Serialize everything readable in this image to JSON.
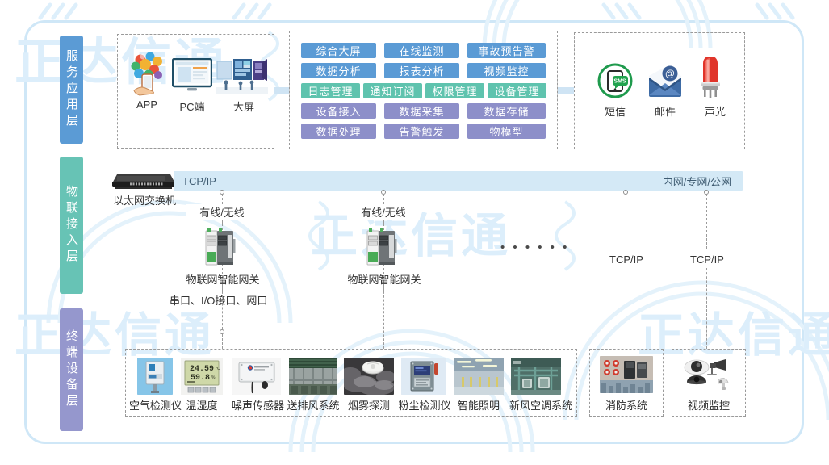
{
  "layers": [
    {
      "id": "service-application-layer",
      "label": "服务应用层"
    },
    {
      "id": "iot-access-layer",
      "label": "物联接入层"
    },
    {
      "id": "terminal-device-layer",
      "label": "终端设备层"
    }
  ],
  "clients": {
    "items": [
      {
        "id": "app",
        "label": "APP",
        "icon": "app-tree-icon"
      },
      {
        "id": "pc",
        "label": "PC端",
        "icon": "monitor-icon"
      },
      {
        "id": "bigscreen",
        "label": "大屏",
        "icon": "video-wall-icon"
      }
    ]
  },
  "platform": {
    "rows": [
      {
        "color": "blue",
        "items": [
          {
            "label": "综合大屏"
          },
          {
            "label": "在线监测"
          },
          {
            "label": "事故预告警"
          }
        ]
      },
      {
        "color": "blue",
        "items": [
          {
            "label": "数据分析"
          },
          {
            "label": "报表分析"
          },
          {
            "label": "视频监控"
          }
        ]
      },
      {
        "color": "teal",
        "items": [
          {
            "label": "日志管理"
          },
          {
            "label": "通知订阅"
          },
          {
            "label": "权限管理"
          },
          {
            "label": "设备管理"
          }
        ]
      },
      {
        "color": "purple",
        "items": [
          {
            "label": "设备接入"
          },
          {
            "label": "数据采集"
          },
          {
            "label": "数据存储"
          }
        ]
      },
      {
        "color": "purple",
        "items": [
          {
            "label": "数据处理"
          },
          {
            "label": "告警触发"
          },
          {
            "label": "物模型"
          }
        ]
      }
    ]
  },
  "notify": {
    "items": [
      {
        "id": "sms",
        "label": "短信",
        "icon": "sms-phone-icon",
        "color": "#1f9a4d"
      },
      {
        "id": "email",
        "label": "邮件",
        "icon": "envelope-at-icon",
        "color": "#31578f"
      },
      {
        "id": "alarm",
        "label": "声光",
        "icon": "beacon-light-icon",
        "color": "#d9342b"
      }
    ]
  },
  "access": {
    "switch": {
      "label": "以太网交换机",
      "icon": "ethernet-switch-icon"
    },
    "network_bar": {
      "left_label": "TCP/IP",
      "right_label": "内网/专网/公网",
      "color": "#d4e9f6"
    },
    "gateways": [
      {
        "id": "gateway-1",
        "link_label": "有线/无线",
        "label": "物联网智能网关"
      },
      {
        "id": "gateway-2",
        "link_label": "有线/无线",
        "label": "物联网智能网关"
      }
    ],
    "ellipsis": "• • • • • •",
    "right_links": [
      {
        "label": "TCP/IP"
      },
      {
        "label": "TCP/IP"
      }
    ]
  },
  "terminal": {
    "bus_label": "串口、I/O接口、网口",
    "devices": [
      {
        "id": "air-detector",
        "label": "空气检测仪",
        "icon": "air-quality-detector-icon"
      },
      {
        "id": "temp-humidity",
        "label": "温湿度",
        "icon": "temperature-humidity-icon",
        "readout_temp": "24.59",
        "readout_humidity": "59.8"
      },
      {
        "id": "noise-sensor",
        "label": "噪声传感器",
        "icon": "noise-sensor-icon"
      },
      {
        "id": "ventilation",
        "label": "送排风系统",
        "icon": "ventilation-system-icon"
      },
      {
        "id": "smoke-detector",
        "label": "烟雾探测",
        "icon": "smoke-detector-icon"
      },
      {
        "id": "dust-detector",
        "label": "粉尘检测仪",
        "icon": "dust-detector-icon"
      },
      {
        "id": "smart-lighting",
        "label": "智能照明",
        "icon": "smart-lighting-icon"
      },
      {
        "id": "fresh-air-hvac",
        "label": "新风空调系统",
        "icon": "hvac-system-icon"
      }
    ],
    "fire": {
      "id": "fire-system",
      "label": "消防系统",
      "icon": "fire-alarm-panel-icon"
    },
    "cctv": {
      "id": "video-surveillance",
      "label": "视频监控",
      "icon": "cctv-camera-icon"
    }
  },
  "watermarks": [
    {
      "text": "正达信通"
    },
    {
      "text": "正达信通"
    },
    {
      "text": "正达信通"
    },
    {
      "text": "正达信通"
    }
  ],
  "colors": {
    "blue": "#5b9bd5",
    "teal": "#5fc3ae",
    "purple": "#8d8fc9",
    "rail_blue": "#5b9bd5",
    "rail_teal": "#67c3b5",
    "rail_purple": "#9597cd",
    "netbar": "#d4e9f6",
    "frame": "#cfe7f7"
  }
}
